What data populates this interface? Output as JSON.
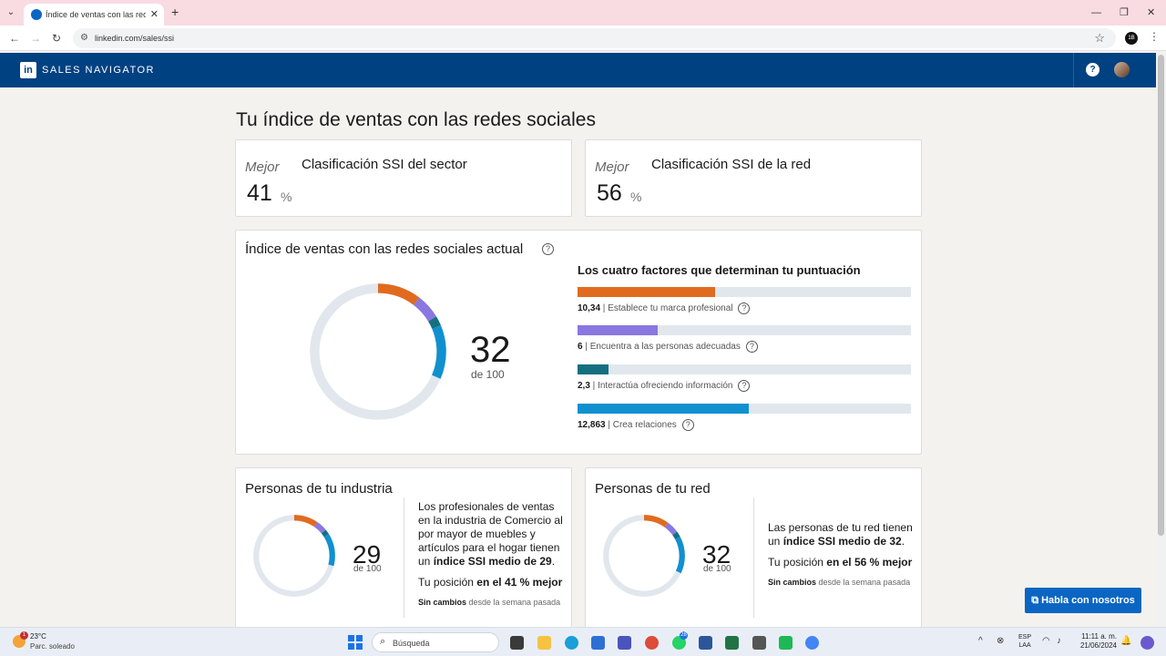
{
  "browser": {
    "tab_title": "Índice de ventas con las redes sociales",
    "url": "linkedin.com/sales/ssi",
    "profile_initials": "1B"
  },
  "header": {
    "logo": "in",
    "brand": "SALES NAVIGATOR",
    "help": "?"
  },
  "page": {
    "title": "Tu índice de ventas con las redes sociales"
  },
  "ranks": [
    {
      "prefix": "Mejor",
      "title": "Clasificación SSI del sector",
      "value": "41",
      "unit": "%"
    },
    {
      "prefix": "Mejor",
      "title": "Clasificación SSI de la red",
      "value": "56",
      "unit": "%"
    }
  ],
  "ssi": {
    "title": "Índice de ventas con las redes sociales actual",
    "score": "32",
    "of": "de 100",
    "factors_title": "Los cuatro factores que determinan tu puntuación",
    "max_per_factor": 25,
    "factors": [
      {
        "value_text": "10,34",
        "value": 10.34,
        "label": "Establece tu marca profesional",
        "color": "#e06b1f"
      },
      {
        "value_text": "6",
        "value": 6,
        "label": "Encuentra a las personas adecuadas",
        "color": "#8a77e0"
      },
      {
        "value_text": "2,3",
        "value": 2.3,
        "label": "Interactúa ofreciendo información",
        "color": "#147080"
      },
      {
        "value_text": "12,863",
        "value": 12.863,
        "label": "Crea relaciones",
        "color": "#1190cf"
      }
    ]
  },
  "industry": {
    "title": "Personas de tu industria",
    "score": "29",
    "of": "de 100",
    "segments": [
      9.5,
      4.5,
      2,
      13
    ],
    "text_pre": "Los profesionales de ventas en la industria de Comercio al por mayor de muebles y artículos para el hogar tienen un ",
    "text_bold": "índice SSI medio de 29",
    "text_post": ".",
    "pos_pre": "Tu posición ",
    "pos_bold": "en el 41 % mejor",
    "change_bold": "Sin cambios",
    "change_rest": " desde la semana pasada"
  },
  "network": {
    "title": "Personas de tu red",
    "score": "32",
    "of": "de 100",
    "segments": [
      10,
      5,
      2.2,
      14.8
    ],
    "text_pre": "Las personas de tu red tienen un ",
    "text_bold": "índice SSI medio de 32",
    "text_post": ".",
    "pos_pre": "Tu posición ",
    "pos_bold": "en el 56 % mejor",
    "change_bold": "Sin cambios",
    "change_rest": " desde la semana pasada"
  },
  "chat_button": "Habla con nosotros",
  "taskbar": {
    "weather_temp": "23°C",
    "weather_desc": "Parc. soleado",
    "weather_badge": "1",
    "search_label": "Búsqueda",
    "lang_line1": "ESP",
    "lang_line2": "LAA",
    "time": "11:11 a. m.",
    "date": "21/06/2024",
    "whatsapp_badge": "28"
  },
  "colors": {
    "segment_1": "#e06b1f",
    "segment_2": "#8a77e0",
    "segment_3": "#147080",
    "segment_4": "#1190cf",
    "track": "#e1e7ed"
  }
}
